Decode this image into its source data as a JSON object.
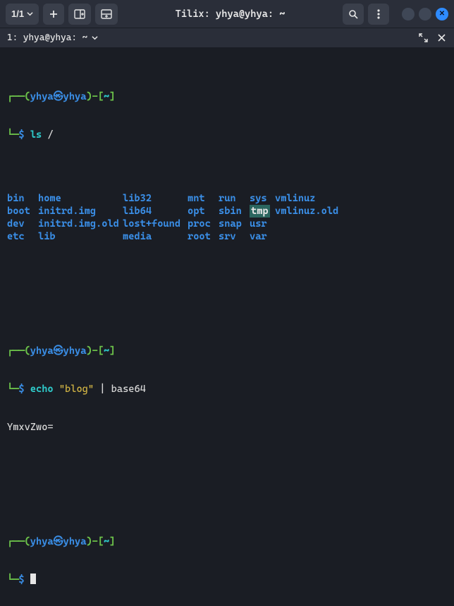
{
  "window": {
    "title": "Tilix: yhya@yhya: ~",
    "session_count": "1/1"
  },
  "session": {
    "title": "1: yhya@yhya: ~"
  },
  "prompt": {
    "l_paren": "(",
    "user": "yhya",
    "at": "㉿",
    "host": "yhya",
    "r_paren": ")-",
    "path_open": "[",
    "path": "~",
    "path_close": "]",
    "symbol": "$"
  },
  "cmd1": {
    "bin": "ls",
    "arg": "/"
  },
  "ls": {
    "rows": [
      [
        "bin",
        "home",
        "lib32",
        "mnt",
        "run",
        "sys",
        "vmlinuz"
      ],
      [
        "boot",
        "initrd.img",
        "lib64",
        "opt",
        "sbin",
        "tmp",
        "vmlinuz.old"
      ],
      [
        "dev",
        "initrd.img.old",
        "lost+found",
        "proc",
        "snap",
        "usr",
        ""
      ],
      [
        "etc",
        "lib",
        "media",
        "root",
        "srv",
        "var",
        ""
      ]
    ],
    "sticky": "tmp"
  },
  "cmd2": {
    "bin": "echo",
    "arg_quoted": "\"blog\"",
    "pipe": "|",
    "bin2": "base64"
  },
  "output2": "YmxvZwo="
}
